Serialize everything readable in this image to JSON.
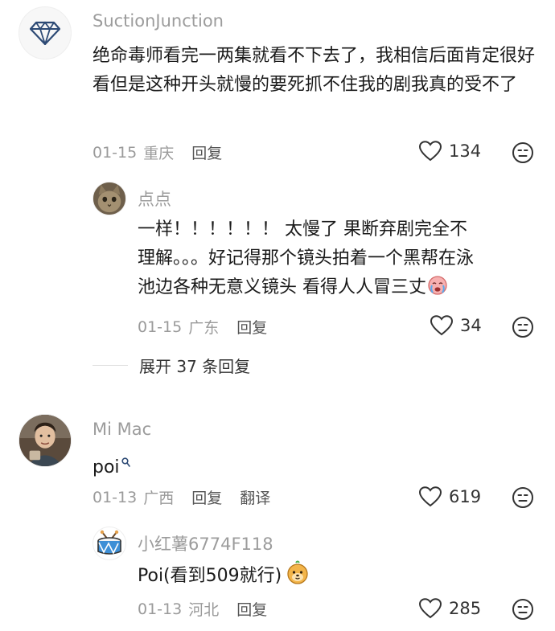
{
  "comments": [
    {
      "username": "SuctionJunction",
      "avatar_icon": "diamond-icon",
      "text": "绝命毒师看完一两集就看不下去了，我相信后面肯定很好看但是这种开头就慢的要死抓不住我的剧我真的受不了",
      "date": "01-15",
      "location": "重庆",
      "reply_label": "回复",
      "likes": "134",
      "replies": [
        {
          "username": "点点",
          "avatar_icon": "cat-avatar-icon",
          "text_part1": "一样！！！！！！ 太慢了 果断弃剧完全不理解。。。好记得那个镜头拍着一个黑帮在泳池边各种无意义镜头 看得",
          "text_part2": "人人冒三丈",
          "date": "01-15",
          "location": "广东",
          "reply_label": "回复",
          "likes": "34"
        }
      ],
      "expand_label": "展开 37 条回复"
    },
    {
      "username": "Mi Mac",
      "avatar_icon": "person-avatar-icon",
      "text": "poi",
      "date": "01-13",
      "location": "广西",
      "reply_label": "回复",
      "translate_label": "翻译",
      "likes": "619",
      "replies": [
        {
          "username": "小红薯6774F118",
          "avatar_icon": "drum-avatar-icon",
          "text": "Poi(看到509就行)",
          "date": "01-13",
          "location": "河北",
          "reply_label": "回复",
          "likes": "285"
        }
      ]
    }
  ]
}
